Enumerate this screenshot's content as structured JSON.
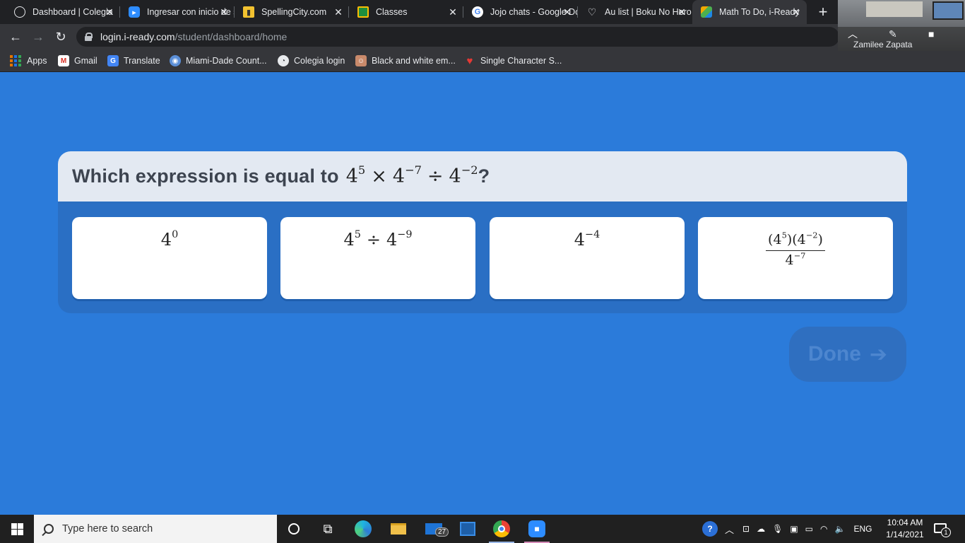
{
  "browser": {
    "tabs": [
      {
        "title": "Dashboard | Colegia",
        "icon": "globe-icon"
      },
      {
        "title": "Ingresar con inicio de sesión",
        "icon": "zoom-icon"
      },
      {
        "title": "SpellingCity.com",
        "icon": "spellingcity-icon"
      },
      {
        "title": "Classes",
        "icon": "google-classroom-icon"
      },
      {
        "title": "Jojo chats - Google Docs",
        "icon": "google-icon"
      },
      {
        "title": "Au list | Boku No Hero",
        "icon": "heart-outline-icon"
      },
      {
        "title": "Math To Do, i-Ready",
        "icon": "i-ready-icon",
        "active": true
      }
    ],
    "url_host": "login.i-ready.com",
    "url_path": "/student/dashboard/home",
    "bookmarks": [
      {
        "label": "Apps",
        "icon": "apps-grid-icon"
      },
      {
        "label": "Gmail",
        "icon": "gmail-icon"
      },
      {
        "label": "Translate",
        "icon": "translate-icon"
      },
      {
        "label": "Miami-Dade Count...",
        "icon": "miami-dade-icon"
      },
      {
        "label": "Colegia login",
        "icon": "colegia-icon"
      },
      {
        "label": "Black and white em...",
        "icon": "avatar-icon"
      },
      {
        "label": "Single Character S...",
        "icon": "heart-icon"
      }
    ]
  },
  "video_call": {
    "participant": "Zamilee Zapata"
  },
  "question": {
    "prompt": "Which expression is equal to",
    "expression": {
      "base": "4",
      "exp1": "5",
      "times": "×",
      "exp2": "−7",
      "divide": "÷",
      "exp3": "−2"
    },
    "question_mark": "?"
  },
  "choices": [
    {
      "base": "4",
      "exp": "0"
    },
    {
      "base": "4",
      "exp_a": "5",
      "op": "÷",
      "exp_b": "−9"
    },
    {
      "base": "4",
      "exp": "−4"
    },
    {
      "numerator_a_base": "4",
      "numerator_a_exp": "5",
      "numerator_b_base": "4",
      "numerator_b_exp": "−2",
      "denominator_base": "4",
      "denominator_exp": "−7"
    }
  ],
  "done_button": {
    "label": "Done",
    "enabled": false
  },
  "taskbar": {
    "search_placeholder": "Type here to search",
    "mail_badge": "27",
    "language": "ENG",
    "time": "10:04 AM",
    "date": "1/14/2021",
    "notifications": "1"
  },
  "colors": {
    "page_background": "#2b7bda",
    "card_header": "#e3e9f2",
    "choice_background": "#ffffff"
  }
}
